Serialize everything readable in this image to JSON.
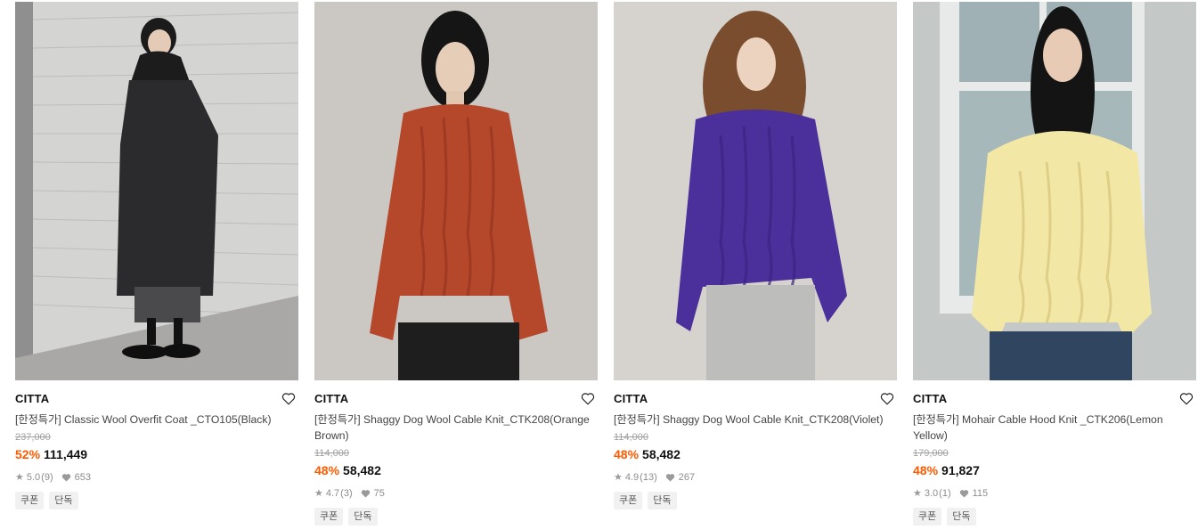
{
  "products": [
    {
      "brand": "CITTA",
      "title": "[한정특가] Classic Wool Overfit Coat _CTO105(Black)",
      "original_price": "237,000",
      "discount": "52%",
      "price": "111,449",
      "rating": "5.0",
      "rating_count": "(9)",
      "likes": "653",
      "tags": [
        "쿠폰",
        "단독"
      ],
      "image_icon": "model-black-coat-image",
      "colors": {
        "bg": "#cfcfcd",
        "garment": "#2b2b2e"
      }
    },
    {
      "brand": "CITTA",
      "title": "[한정특가] Shaggy Dog Wool Cable Knit_CTK208(Orange Brown)",
      "original_price": "114,000",
      "discount": "48%",
      "price": "58,482",
      "rating": "4.7",
      "rating_count": "(3)",
      "likes": "75",
      "tags": [
        "쿠폰",
        "단독"
      ],
      "image_icon": "model-orange-knit-image",
      "colors": {
        "bg": "#cbc8c3",
        "garment": "#b5482b"
      }
    },
    {
      "brand": "CITTA",
      "title": "[한정특가] Shaggy Dog Wool Cable Knit_CTK208(Violet)",
      "original_price": "114,000",
      "discount": "48%",
      "price": "58,482",
      "rating": "4.9",
      "rating_count": "(13)",
      "likes": "267",
      "tags": [
        "쿠폰",
        "단독"
      ],
      "image_icon": "model-violet-knit-image",
      "colors": {
        "bg": "#d6d3ce",
        "garment": "#4b2f9a"
      }
    },
    {
      "brand": "CITTA",
      "title": "[한정특가] Mohair Cable Hood Knit _CTK206(Lemon Yellow)",
      "original_price": "179,000",
      "discount": "48%",
      "price": "91,827",
      "rating": "3.0",
      "rating_count": "(1)",
      "likes": "115",
      "tags": [
        "쿠폰",
        "단독"
      ],
      "image_icon": "model-yellow-hood-knit-image",
      "colors": {
        "bg": "#c9cfd0",
        "garment": "#f3e7a6"
      }
    }
  ],
  "accent_color": "#ff5a00"
}
